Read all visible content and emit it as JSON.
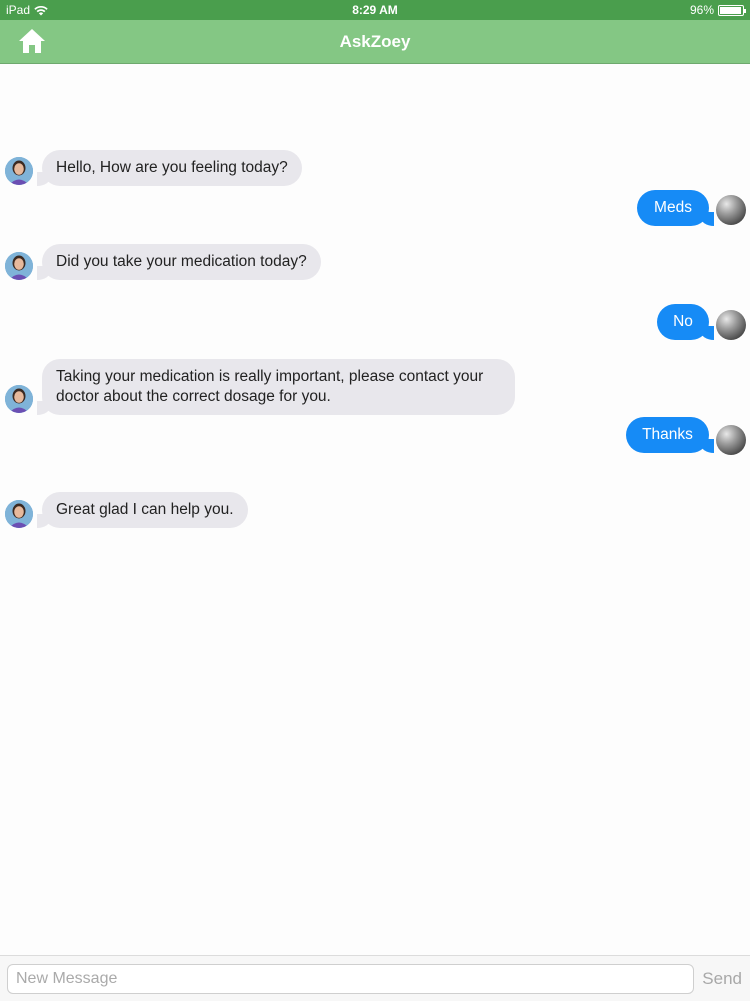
{
  "status_bar": {
    "device": "iPad",
    "time": "8:29 AM",
    "battery_text": "96%",
    "battery_level": 0.96
  },
  "nav": {
    "title": "AskZoey",
    "home_icon": "home-icon"
  },
  "messages": [
    {
      "from": "zoey",
      "lines": [
        "Hello, How are you feeling today?"
      ]
    },
    {
      "from": "user",
      "lines": [
        "Meds"
      ]
    },
    {
      "from": "zoey",
      "lines": [
        "Did you take your medication today?"
      ]
    },
    {
      "from": "user",
      "lines": [
        "No"
      ]
    },
    {
      "from": "zoey",
      "lines": [
        "Taking your medication is really important, please contact your",
        "doctor about the correct dosage for you."
      ]
    },
    {
      "from": "user",
      "lines": [
        "Thanks"
      ]
    },
    {
      "from": "zoey",
      "lines": [
        "Great glad I can help you."
      ]
    }
  ],
  "composer": {
    "placeholder": "New Message",
    "send_label": "Send"
  },
  "colors": {
    "status_bar": "#4a9e4d",
    "nav_bar": "#84c784",
    "incoming_bubble": "#e8e7ec",
    "outgoing_bubble": "#168bf6"
  }
}
